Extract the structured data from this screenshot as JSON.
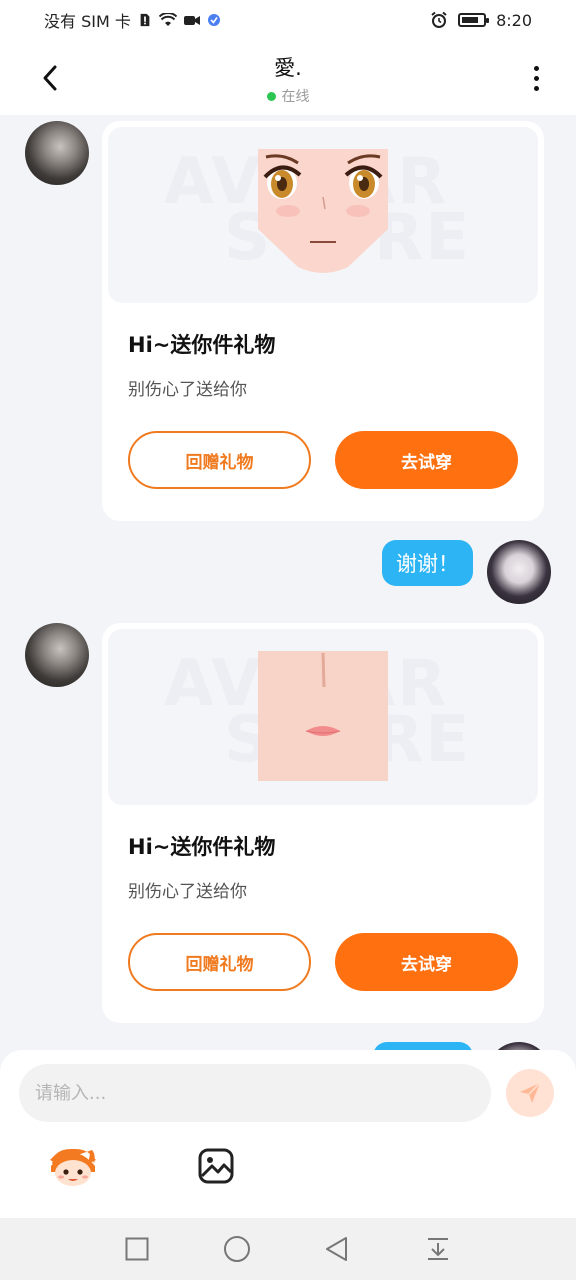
{
  "status_bar": {
    "carrier": "没有 SIM 卡",
    "time": "8:20",
    "battery_level": 0.8,
    "icons": [
      "sim-alert-icon",
      "wifi-icon",
      "video-icon",
      "app-badge-icon",
      "alarm-icon",
      "battery-icon"
    ]
  },
  "header": {
    "title": "愛.",
    "status": "在线",
    "back_icon": "chevron-left-icon",
    "more_icon": "more-vertical-icon",
    "online_color": "#2bc551"
  },
  "messages": [
    {
      "type": "gift",
      "side": "left",
      "preview_item": "face-eyes",
      "watermark": [
        "AVATAR",
        "STORE"
      ],
      "title": "Hi~送你件礼物",
      "subtitle": "别伤心了送给你",
      "return_gift_label": "回赠礼物",
      "try_on_label": "去试穿"
    },
    {
      "type": "text",
      "side": "right",
      "text": "谢谢！"
    },
    {
      "type": "gift",
      "side": "left",
      "preview_item": "face-mouth",
      "watermark": [
        "AVATAR",
        "STORE"
      ],
      "title": "Hi~送你件礼物",
      "subtitle": "别伤心了送给你",
      "return_gift_label": "回赠礼物",
      "try_on_label": "去试穿"
    },
    {
      "type": "text",
      "side": "right",
      "text": ""
    }
  ],
  "composer": {
    "placeholder": "请输入...",
    "value": "",
    "send_icon": "send-icon",
    "tools": [
      "avatar-sticker-icon",
      "image-icon"
    ]
  },
  "colors": {
    "accent_orange": "#ff7010",
    "bubble_blue": "#2cb4f5",
    "background": "#f3f4f8"
  },
  "nav_bar": {
    "icons": [
      "recent-apps-icon",
      "home-icon",
      "back-icon",
      "notification-pull-icon"
    ]
  }
}
